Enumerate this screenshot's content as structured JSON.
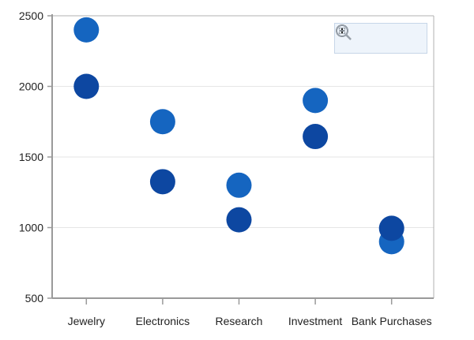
{
  "chart_data": {
    "type": "scatter",
    "categories": [
      "Jewelry",
      "Electronics",
      "Research",
      "Investment",
      "Bank Purchases"
    ],
    "series": [
      {
        "values": [
          2400,
          1750,
          1300,
          1900,
          900
        ],
        "color": "#1565c0"
      },
      {
        "values": [
          2000,
          1325,
          1055,
          1645,
          995
        ],
        "color": "#0d47a1"
      }
    ],
    "ylim": [
      500,
      2500
    ],
    "yticks": [
      "500",
      "1000",
      "1500",
      "2000",
      "2500"
    ],
    "title": "",
    "xlabel": "",
    "ylabel": "",
    "grid": true,
    "legend": "none"
  },
  "toolbar": {
    "icons": [
      "zoom-in-icon",
      "zoom-out-icon",
      "reset-zoom-icon"
    ]
  }
}
